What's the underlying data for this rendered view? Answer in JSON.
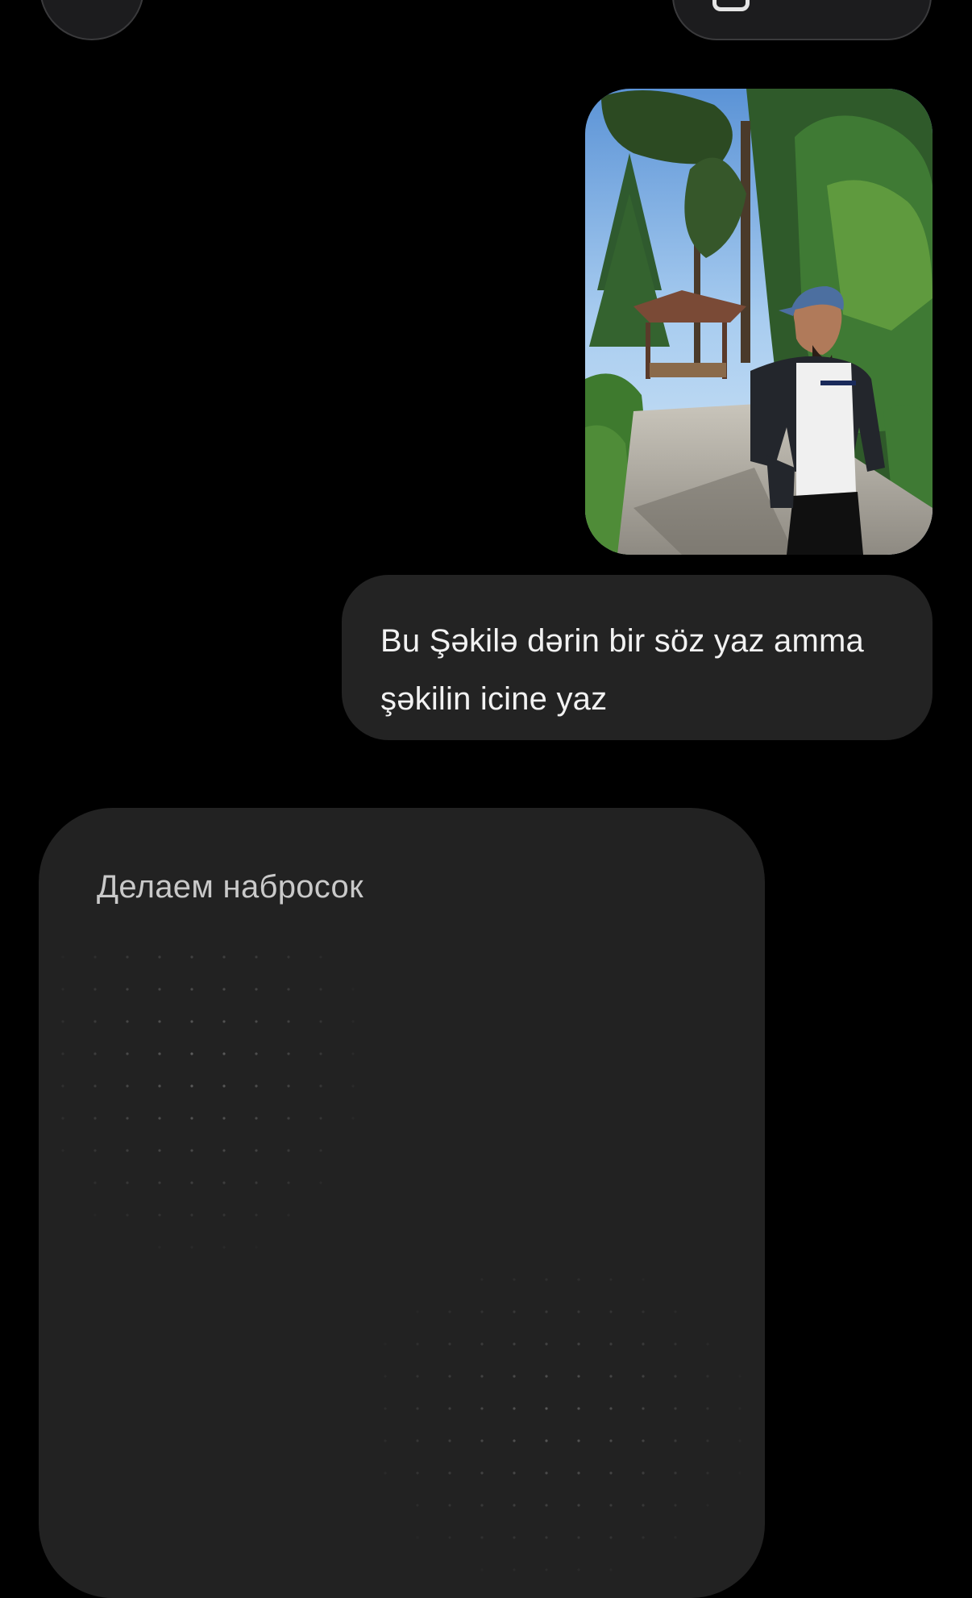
{
  "top_bar": {
    "left_button_icon": "circle-button",
    "right_pill_icon": "share-icon"
  },
  "messages": [
    {
      "type": "image",
      "from": "user",
      "alt": "photo-of-man-in-park"
    },
    {
      "type": "text",
      "from": "user",
      "lines": [
        "Bu Şəkilə dərin bir söz yaz amma",
        "şəkilin icine yaz"
      ]
    }
  ],
  "assistant": {
    "status_title": "Делаем набросок",
    "placeholder": "sketch-loading-dots"
  },
  "colors": {
    "background": "#000000",
    "bubble": "#232323",
    "card": "#222222",
    "text": "#f2f2f2",
    "muted_text": "#c9c9c9"
  }
}
